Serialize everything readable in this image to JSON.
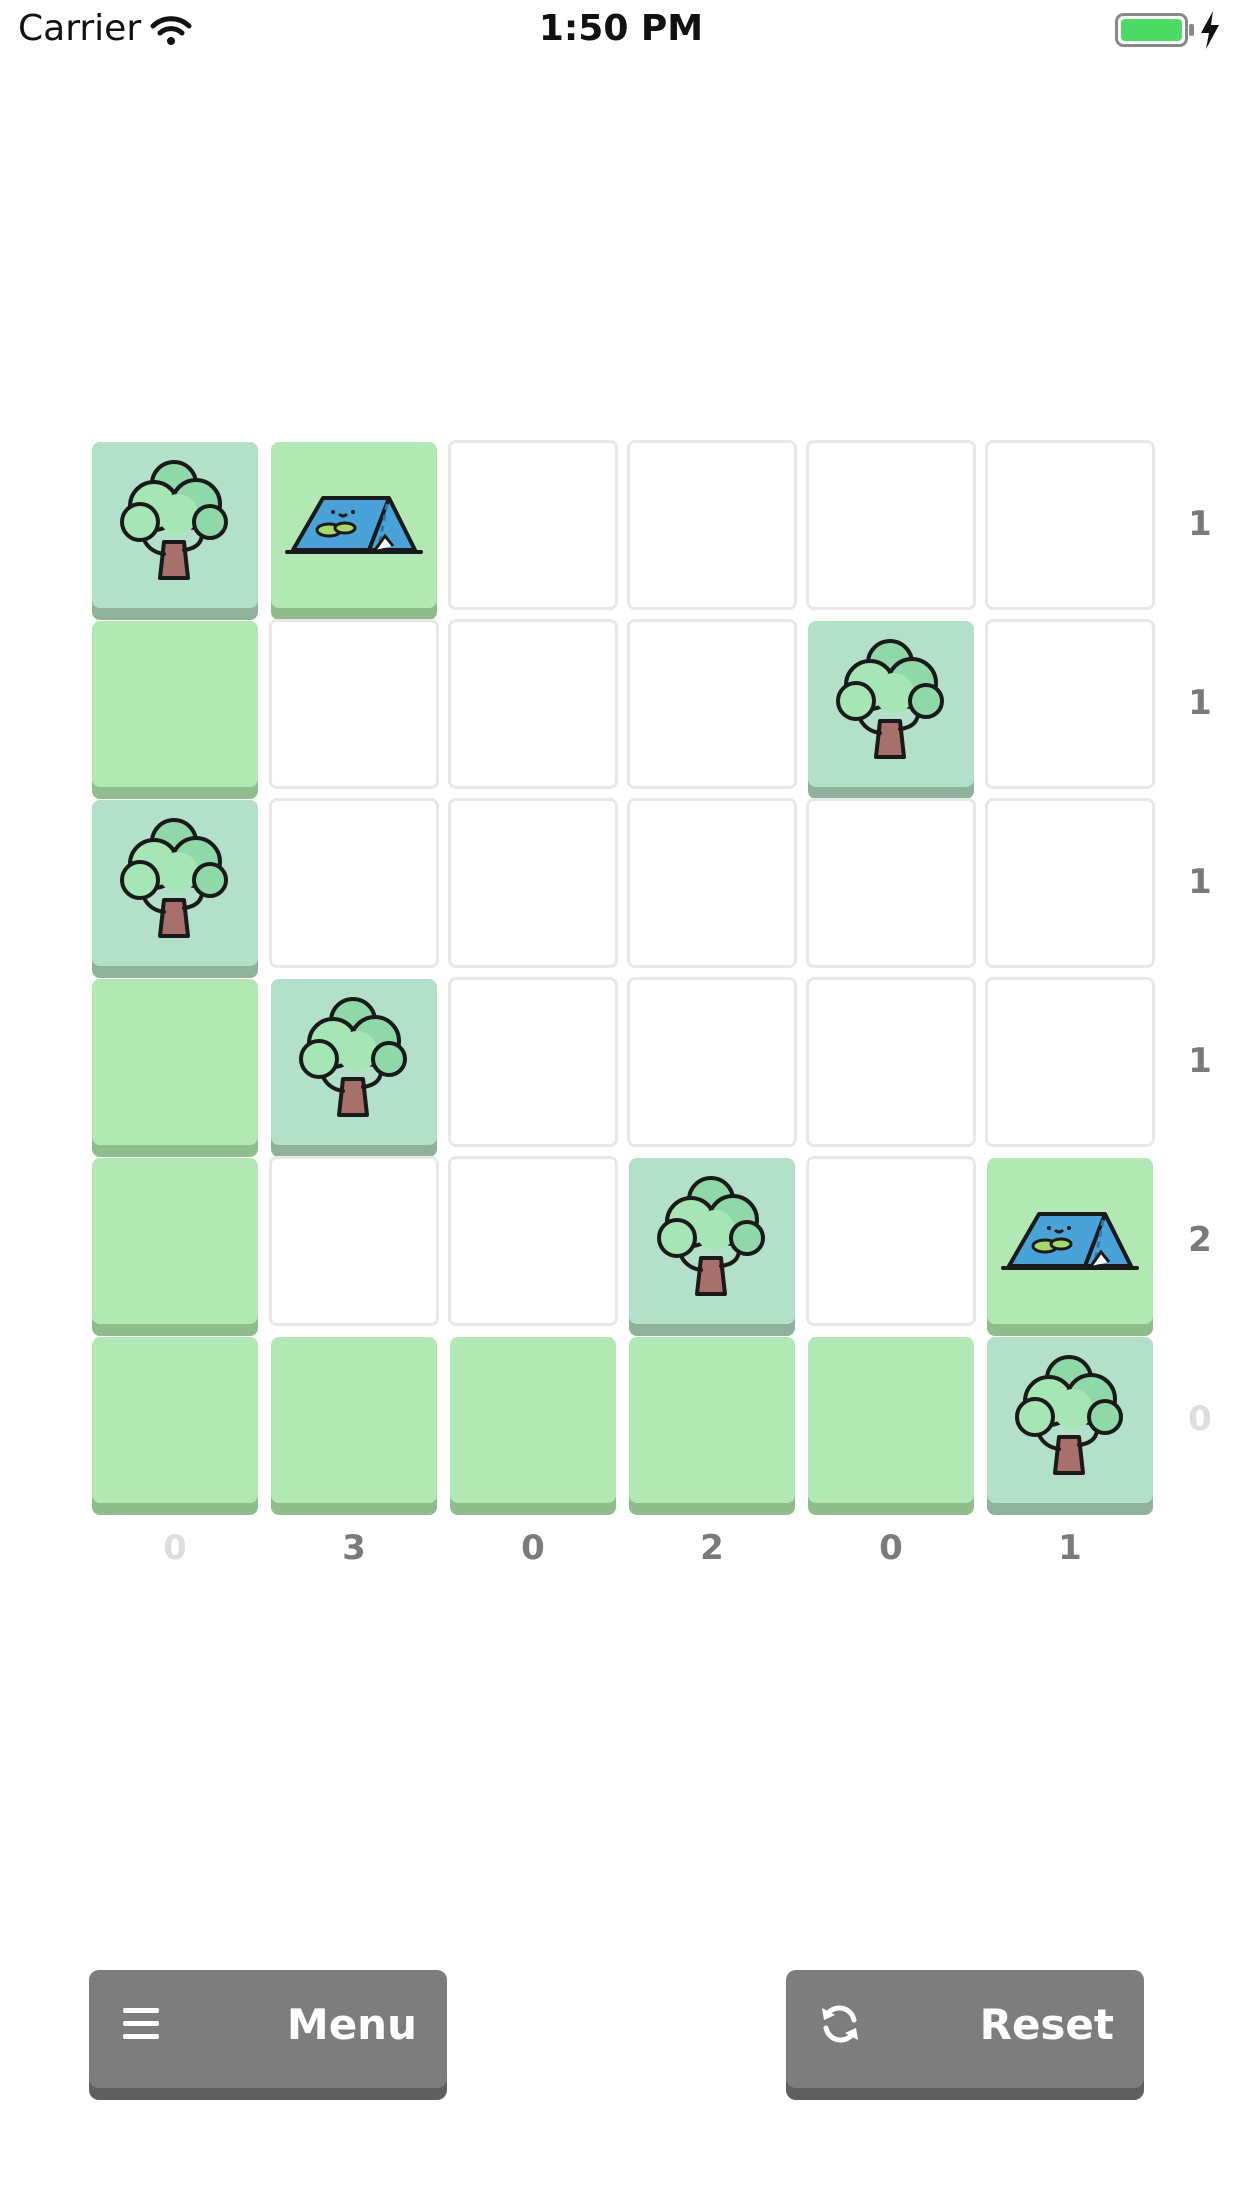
{
  "status_bar": {
    "carrier": "Carrier",
    "time": "1:50 PM",
    "battery_color": "#4cd964"
  },
  "board": {
    "rows": 6,
    "cols": 6,
    "grid": [
      [
        "tree",
        "tent",
        "empty",
        "empty",
        "empty",
        "empty"
      ],
      [
        "grass",
        "empty",
        "empty",
        "empty",
        "tree",
        "empty"
      ],
      [
        "tree",
        "empty",
        "empty",
        "empty",
        "empty",
        "empty"
      ],
      [
        "grass",
        "tree",
        "empty",
        "empty",
        "empty",
        "empty"
      ],
      [
        "grass",
        "empty",
        "empty",
        "tree",
        "empty",
        "tent"
      ],
      [
        "grass",
        "grass",
        "grass",
        "grass",
        "grass",
        "tree"
      ]
    ],
    "row_clues": [
      {
        "value": "1",
        "state": "open"
      },
      {
        "value": "1",
        "state": "open"
      },
      {
        "value": "1",
        "state": "open"
      },
      {
        "value": "1",
        "state": "open"
      },
      {
        "value": "2",
        "state": "open"
      },
      {
        "value": "0",
        "state": "done"
      }
    ],
    "col_clues": [
      {
        "value": "0",
        "state": "done"
      },
      {
        "value": "3",
        "state": "open"
      },
      {
        "value": "0",
        "state": "open"
      },
      {
        "value": "2",
        "state": "open"
      },
      {
        "value": "0",
        "state": "open"
      },
      {
        "value": "1",
        "state": "open"
      }
    ]
  },
  "colors": {
    "grass": "#b2e8b4",
    "tree_tile": "#b2e0c9",
    "button": "#7d7d7d"
  },
  "buttons": {
    "menu_label": "Menu",
    "menu_icon": "hamburger-icon",
    "reset_label": "Reset",
    "reset_icon": "refresh-icon"
  }
}
